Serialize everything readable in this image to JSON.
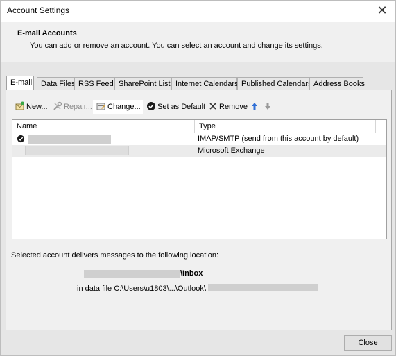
{
  "window": {
    "title": "Account Settings",
    "close_glyph": "✕"
  },
  "header": {
    "title": "E-mail Accounts",
    "description": "You can add or remove an account. You can select an account and change its settings."
  },
  "tabs": [
    {
      "label": "E-mail",
      "active": true
    },
    {
      "label": "Data Files"
    },
    {
      "label": "RSS Feeds"
    },
    {
      "label": "SharePoint Lists"
    },
    {
      "label": "Internet Calendars"
    },
    {
      "label": "Published Calendars"
    },
    {
      "label": "Address Books"
    }
  ],
  "toolbar": {
    "new_label": "New...",
    "repair_label": "Repair...",
    "change_label": "Change...",
    "set_default_label": "Set as Default",
    "remove_label": "Remove"
  },
  "list": {
    "columns": {
      "name": "Name",
      "type": "Type"
    },
    "rows": [
      {
        "type": "IMAP/SMTP (send from this account by default)",
        "is_default": true
      },
      {
        "type": "Microsoft Exchange",
        "is_default": false
      }
    ]
  },
  "delivery": {
    "label": "Selected account delivers messages to the following location:",
    "folder": "\\Inbox",
    "data_file": "in data file C:\\Users\\u1803\\...\\Outlook\\"
  },
  "buttons": {
    "close_label": "Close"
  },
  "colors": {
    "accent": "#2f6fd6",
    "window_bg": "#f0f0f0"
  }
}
